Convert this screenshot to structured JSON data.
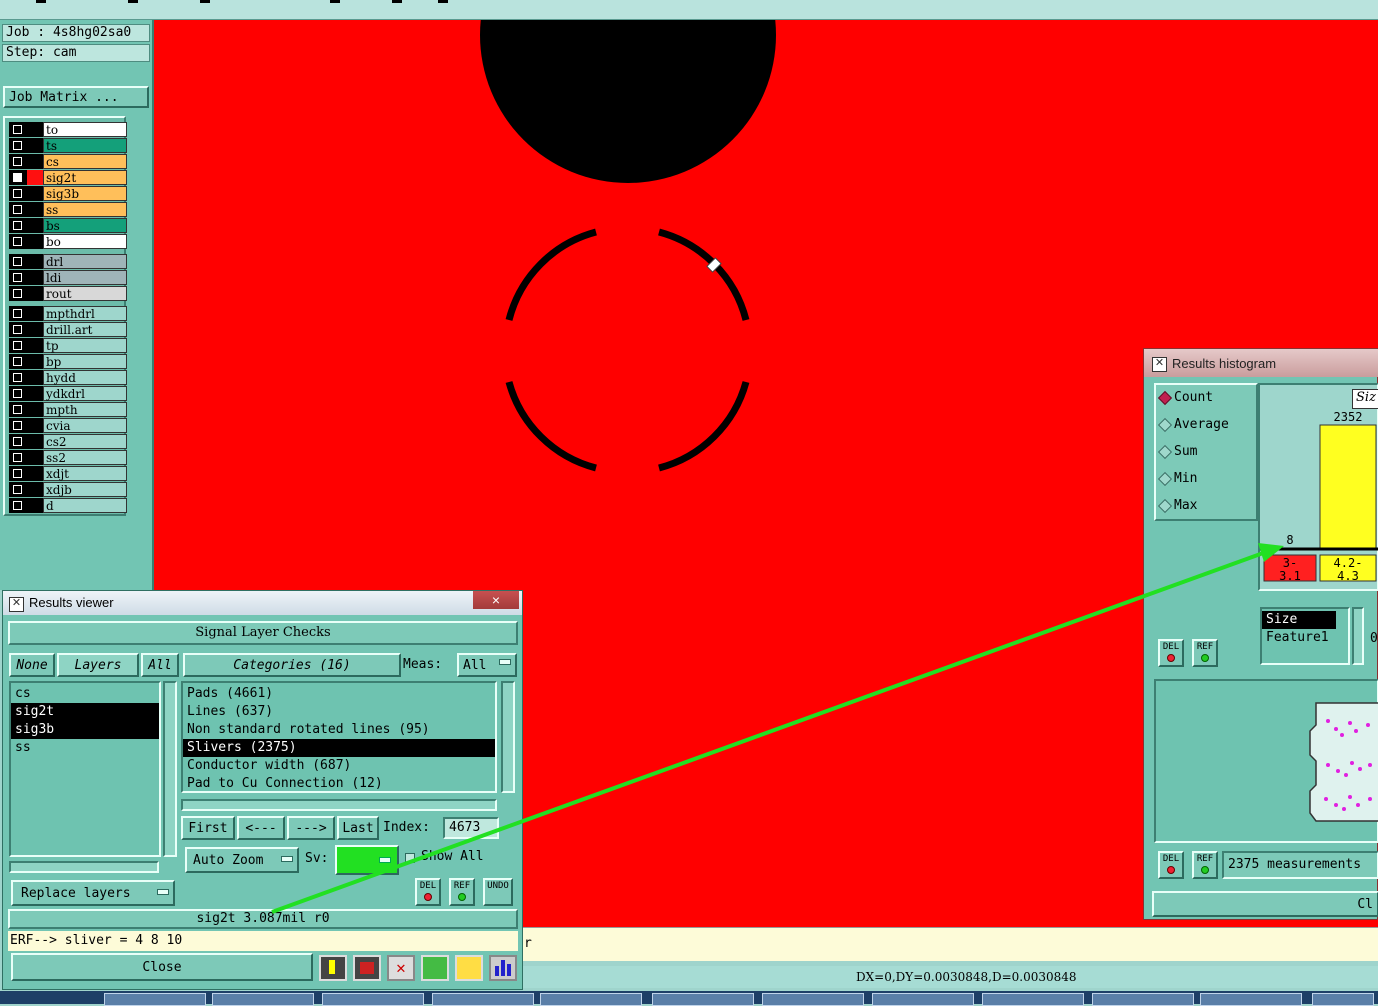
{
  "job": {
    "job_line": "Job : 4s8hg02sa0",
    "step_line": "Step: cam",
    "matrix_button": "Job Matrix ..."
  },
  "layers_board": [
    {
      "name": "to",
      "bg": "#ffffff",
      "color": "#000000",
      "checked": false
    },
    {
      "name": "ts",
      "bg": "#14a07a",
      "color": "#000000",
      "checked": false
    },
    {
      "name": "cs",
      "bg": "#ffbf5a",
      "color": "#000000",
      "checked": false
    },
    {
      "name": "sig2t",
      "bg": "#ffbf5a",
      "color": "#ff1010",
      "checked": true
    },
    {
      "name": "sig3b",
      "bg": "#ffbf5a",
      "color": "#000000",
      "checked": false
    },
    {
      "name": "ss",
      "bg": "#ffbf5a",
      "color": "#000000",
      "checked": false
    },
    {
      "name": "bs",
      "bg": "#14a07a",
      "color": "#000000",
      "checked": false
    },
    {
      "name": "bo",
      "bg": "#ffffff",
      "color": "#000000",
      "checked": false
    }
  ],
  "layers_drill": [
    {
      "name": "drl",
      "bg": "#9fb4b8"
    },
    {
      "name": "ldi",
      "bg": "#9fb4b8"
    },
    {
      "name": "rout",
      "bg": "#d8d8d8"
    }
  ],
  "layers_misc": [
    "mpthdrl",
    "drill.art",
    "tp",
    "bp",
    "hydd",
    "ydkdrl",
    "mpth",
    "cvia",
    "cs2",
    "ss2",
    "xdjt",
    "xdjb",
    "d"
  ],
  "status": {
    "message_tail": "r",
    "coords": "DX=0,DY=0.0030848,D=0.0030848"
  },
  "results_viewer": {
    "title": "Results viewer",
    "close_x": "×",
    "header": "Signal Layer Checks",
    "none_btn": "None",
    "layers_btn": "Layers",
    "all_btn": "All",
    "categories_btn": "Categories (16)",
    "meas_label": "Meas:",
    "meas_value": "All",
    "layer_list": [
      {
        "name": "cs",
        "selected": false
      },
      {
        "name": "sig2t",
        "selected": true
      },
      {
        "name": "sig3b",
        "selected": true
      },
      {
        "name": "ss",
        "selected": false
      }
    ],
    "categories": [
      {
        "name": "Pads (4661)",
        "selected": false
      },
      {
        "name": "Lines (637)",
        "selected": false
      },
      {
        "name": "Non standard rotated lines (95)",
        "selected": false
      },
      {
        "name": "Slivers (2375)",
        "selected": true
      },
      {
        "name": "Conductor width (687)",
        "selected": false
      },
      {
        "name": "Pad to Cu Connection (12)",
        "selected": false
      }
    ],
    "nav": {
      "first": "First",
      "prev": "<---",
      "next": "--->",
      "last": "Last",
      "index_label": "Index:",
      "index_value": "4673"
    },
    "auto_zoom": "Auto Zoom",
    "sv_label": "Sv:",
    "show_all": "Show All",
    "replace_layers": "Replace layers",
    "del": "DEL",
    "ref": "REF",
    "undo": "UNDO",
    "info_line": "sig2t 3.087mil  r0",
    "erf_line": "ERF--> sliver = 4 8 10",
    "close_button": "Close"
  },
  "histogram": {
    "title": "Results histogram",
    "modes": [
      {
        "label": "Count",
        "selected": true
      },
      {
        "label": "Average",
        "selected": false
      },
      {
        "label": "Sum",
        "selected": false
      },
      {
        "label": "Min",
        "selected": false
      },
      {
        "label": "Max",
        "selected": false
      }
    ],
    "size_tab": "Siz",
    "list": [
      "Size",
      "Feature1"
    ],
    "side_value": "0",
    "footer": "2375 measurements",
    "close_partial": "Cl",
    "del": "DEL",
    "ref": "REF"
  },
  "chart_data": {
    "type": "bar",
    "categories": [
      "3-\n3.1",
      "4.2-\n4.3"
    ],
    "values": [
      8,
      2352
    ],
    "colors": [
      "#ff2020",
      "#ffff20"
    ]
  }
}
